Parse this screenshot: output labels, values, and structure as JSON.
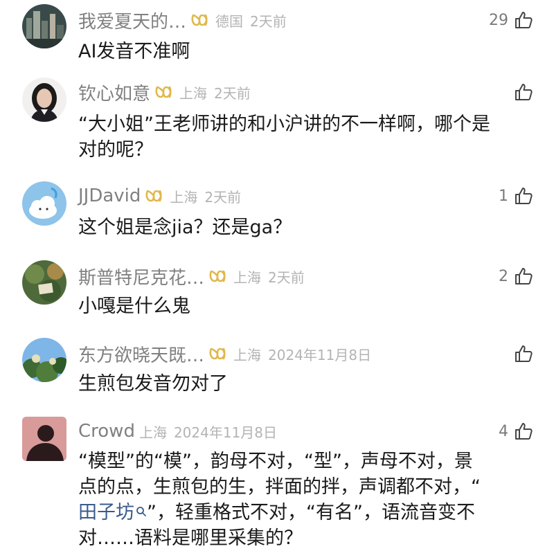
{
  "comments": [
    {
      "name": "我爱夏天的…",
      "location": "德国",
      "time": "2天前",
      "likes": "29",
      "text": "AI发音不准啊"
    },
    {
      "name": "钦心如意",
      "location": "上海",
      "time": "2天前",
      "likes": "",
      "text_line1": "“大小姐”王老师讲的和小沪讲的不一样啊，哪个是",
      "text_line2": "对的呢？"
    },
    {
      "name": "JJDavid",
      "location": "上海",
      "time": "2天前",
      "likes": "1",
      "text": "这个姐是念jia？还是ga？"
    },
    {
      "name": "斯普特尼克花…",
      "location": "上海",
      "time": "2天前",
      "likes": "2",
      "text": "小嘎是什么鬼"
    },
    {
      "name": "东方欲晓天既…",
      "location": "上海",
      "time": "2024年11月8日",
      "likes": "",
      "text": "生煎包发音勿对了"
    },
    {
      "name": "Crowd",
      "location": "上海",
      "time": "2024年11月8日",
      "likes": "4",
      "text_line1": "“模型”的“模”，韵母不对，“型”，声母不对，景",
      "text_line2": "点的点，生煎包的生，拌面的拌，声调都不对，“",
      "text_line3_link": "田子坊",
      "text_line3_rest": "”，轻重格式不对，“有名”，语流音变不",
      "text_line4": "对……语料是哪里采集的？"
    }
  ],
  "icons": {
    "badge": "gold-link-badge-icon",
    "like": "thumbs-up-icon",
    "search": "search-icon"
  },
  "colors": {
    "name": "#808080",
    "meta": "#b3b3b3",
    "text": "#1a1a1a",
    "badge": "#e0b84a",
    "link": "#3a5a8c"
  }
}
